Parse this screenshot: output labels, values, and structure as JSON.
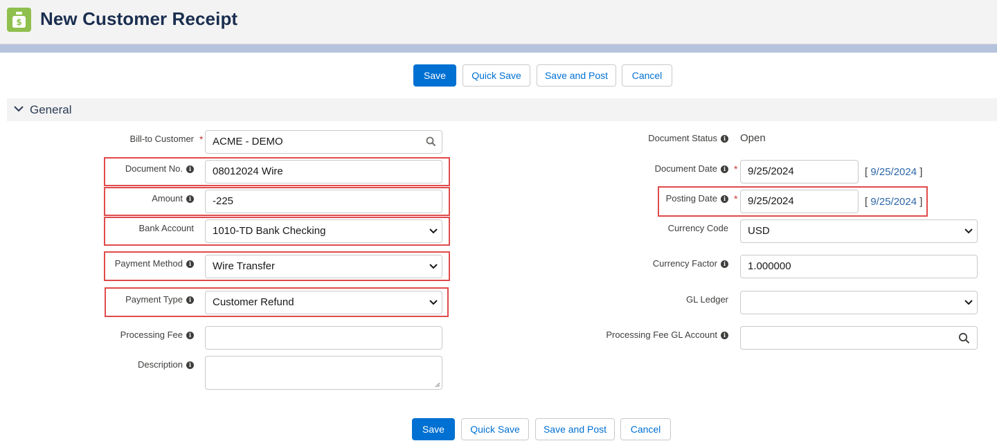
{
  "header": {
    "title": "New Customer Receipt",
    "icon": "money-bag-icon",
    "icon_color": "#8fbf4d"
  },
  "toolbar_top": {
    "save": "Save",
    "quick_save": "Quick Save",
    "save_and_post": "Save and Post",
    "cancel": "Cancel"
  },
  "toolbar_bottom": {
    "save": "Save",
    "quick_save": "Quick Save",
    "save_and_post": "Save and Post",
    "cancel": "Cancel"
  },
  "section": {
    "title": "General"
  },
  "left": {
    "bill_to_customer": {
      "label": "Bill-to Customer",
      "value": "ACME - DEMO",
      "required": "*"
    },
    "document_no": {
      "label": "Document No.",
      "value": "08012024 Wire"
    },
    "amount": {
      "label": "Amount",
      "value": "-225"
    },
    "bank_account": {
      "label": "Bank Account",
      "value": "1010-TD Bank Checking"
    },
    "payment_method": {
      "label": "Payment Method",
      "value": "Wire Transfer"
    },
    "payment_type": {
      "label": "Payment Type",
      "value": "Customer Refund"
    },
    "processing_fee": {
      "label": "Processing Fee",
      "value": ""
    },
    "description": {
      "label": "Description",
      "value": ""
    }
  },
  "right": {
    "document_status": {
      "label": "Document Status",
      "value": "Open"
    },
    "document_date": {
      "label": "Document Date",
      "value": "9/25/2024",
      "link": "9/25/2024",
      "required": "*"
    },
    "posting_date": {
      "label": "Posting Date",
      "value": "9/25/2024",
      "link": "9/25/2024",
      "required": "*"
    },
    "currency_code": {
      "label": "Currency Code",
      "value": "USD"
    },
    "currency_factor": {
      "label": "Currency Factor",
      "value": "1.000000"
    },
    "gl_ledger": {
      "label": "GL Ledger",
      "value": ""
    },
    "processing_fee_gl_account": {
      "label": "Processing Fee GL Account",
      "value": ""
    }
  },
  "colors": {
    "primary": "#0070d2",
    "highlight": "#e04a4a",
    "link": "#2c66a8"
  },
  "symbols": {
    "info": "i",
    "bracket_open": "[",
    "bracket_close": "]"
  }
}
